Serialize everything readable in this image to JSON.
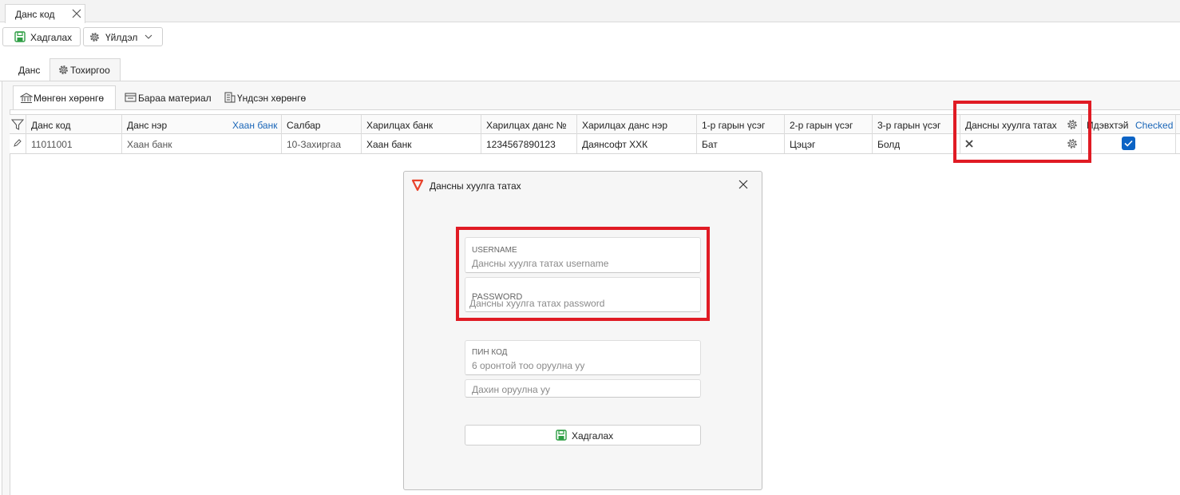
{
  "doc_tab": {
    "label": "Данс код"
  },
  "toolbar": {
    "save_label": "Хадгалах",
    "actions_label": "Үйлдэл"
  },
  "main_tabs": [
    {
      "label": "Данс"
    },
    {
      "label": "Тохиргоо"
    }
  ],
  "sub_tabs": [
    {
      "label": "Мөнгөн хөрөнгө"
    },
    {
      "label": "Бараа материал"
    },
    {
      "label": "Үндсэн хөрөнгө"
    }
  ],
  "grid": {
    "columns": [
      "Данс код",
      "Данс нэр",
      "Хаан банк",
      "Салбар",
      "Харилцах банк",
      "Харилцах данс №",
      "Харилцах данс нэр",
      "1-р гарын үсэг",
      "2-р гарын үсэг",
      "3-р гарын үсэг",
      "Дансны хуулга татах",
      "Идэвхтэй",
      "Checked"
    ],
    "rows": [
      {
        "code": "11011001",
        "name": "Хаан банк",
        "branch": "10-Захиргаа",
        "bank": "Хаан банк",
        "account_no": "1234567890123",
        "account_name": "Даянсофт ХХК",
        "sig1": "Бат",
        "sig2": "Цэцэг",
        "sig3": "Болд",
        "statement_enabled": false,
        "active": true
      }
    ]
  },
  "dialog": {
    "title": "Дансны хуулга татах",
    "username_caption": "USERNAME",
    "username_placeholder": "Дансны хуулга татах username",
    "password_caption": "PASSWORD",
    "password_placeholder": "Дансны хуулга татах password",
    "pin_caption": "ПИН КОД",
    "pin_placeholder": "6 оронтой тоо оруулна уу",
    "pin_repeat_placeholder": "Дахин оруулна уу",
    "save_label": "Хадгалах"
  },
  "colors": {
    "accent": "#0b63c5",
    "highlight": "#e01b24",
    "save_icon": "#2e9e44",
    "logo": "#e8432c"
  }
}
